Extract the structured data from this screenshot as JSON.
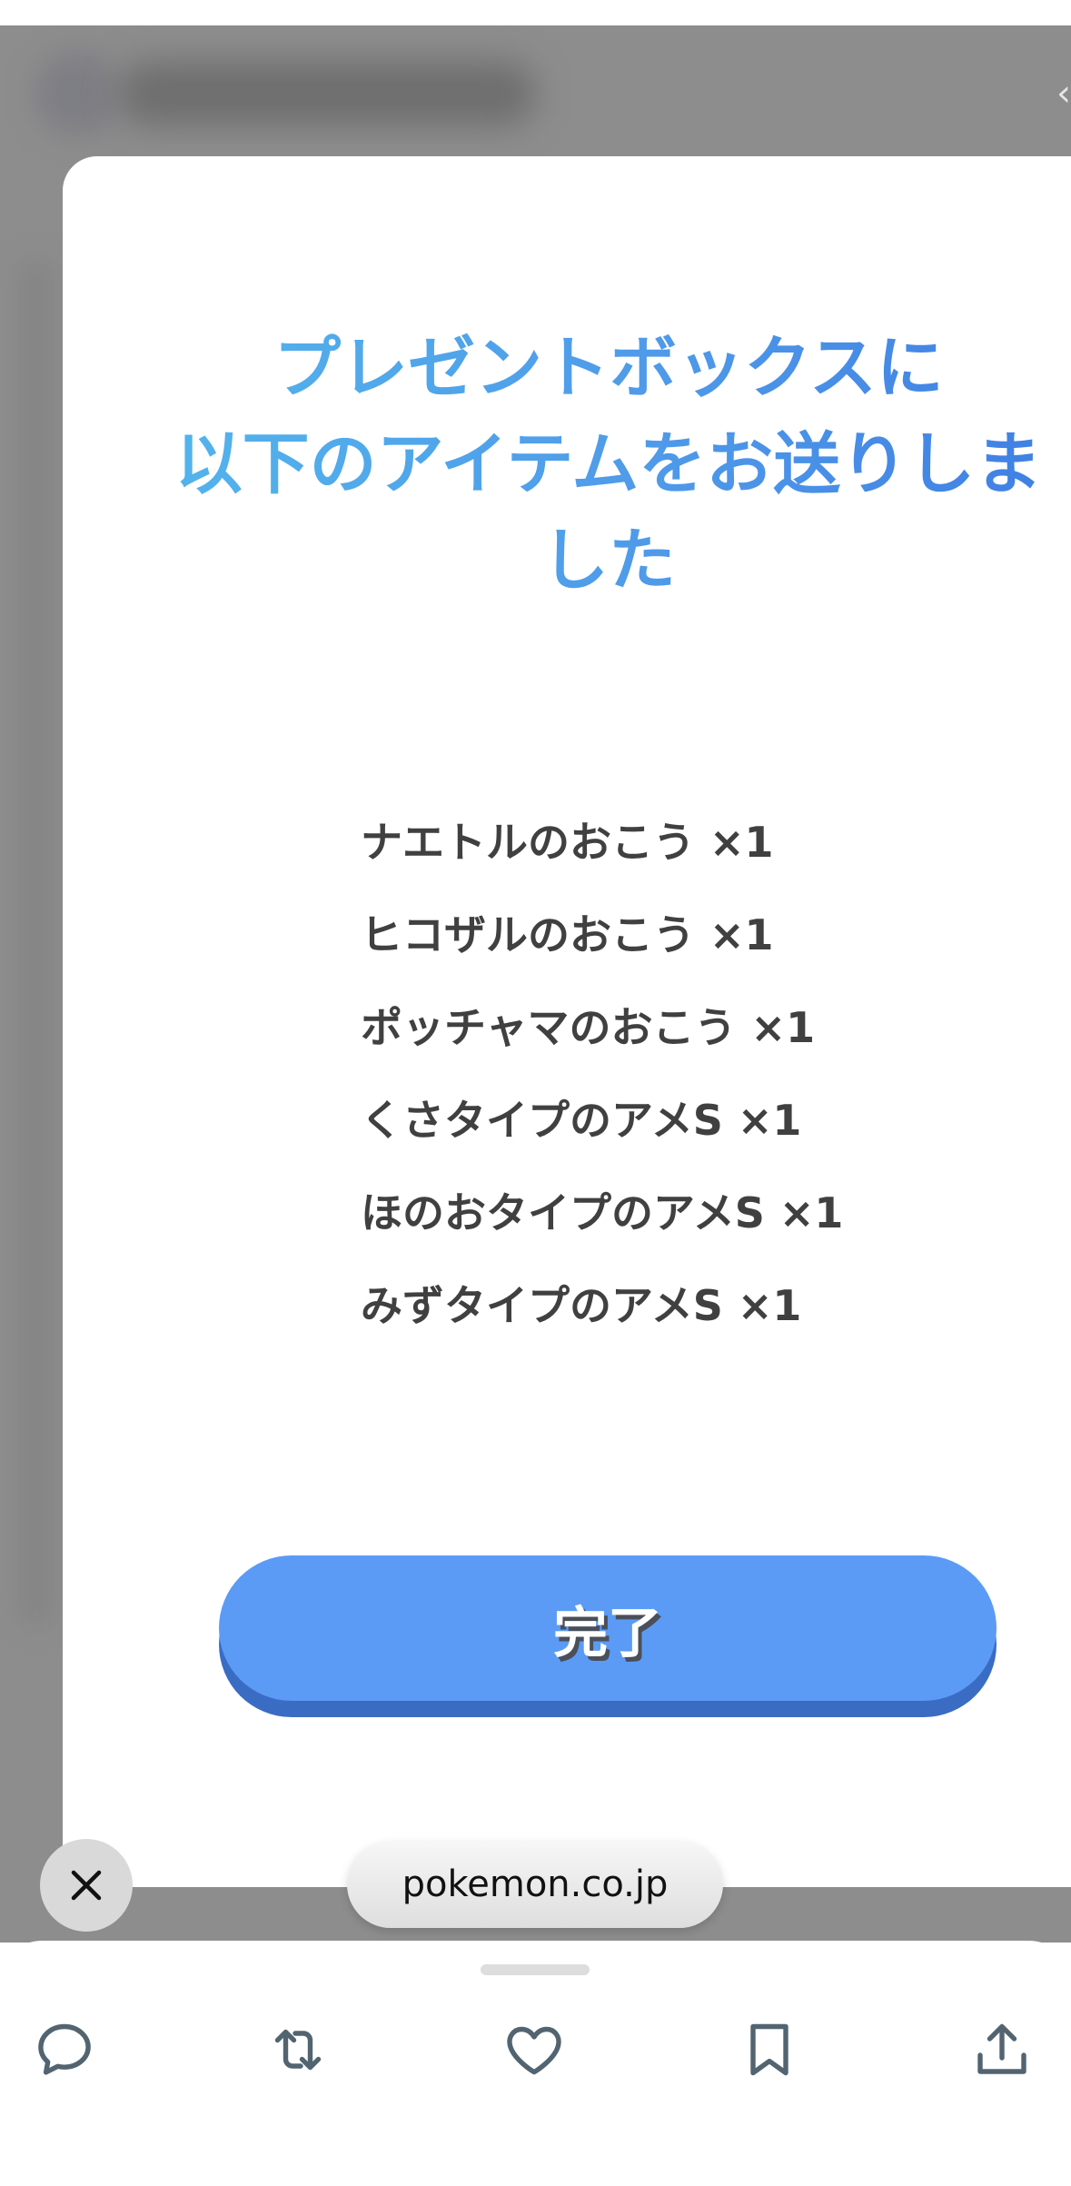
{
  "modal": {
    "title_lines": [
      "プレゼントボックスに",
      "以下のアイテムをお送りしま",
      "した"
    ],
    "items": [
      "ナエトルのおこう ×1",
      "ヒコザルのおこう ×1",
      "ポッチャマのおこう ×1",
      "くさタイプのアメS ×1",
      "ほのおタイプのアメS ×1",
      "みずタイプのアメS ×1"
    ],
    "done_label": "完了"
  },
  "browser": {
    "url": "pokemon.co.jp"
  },
  "actions": {
    "icons": [
      "reply-icon",
      "repost-icon",
      "like-icon",
      "bookmark-icon",
      "share-icon"
    ]
  },
  "colors": {
    "title_gradient": [
      "#52b4ec",
      "#3f7fe4"
    ],
    "button": "#5b9bf5",
    "button_shadow": "#3a6cc3",
    "icon_gray": "#536471",
    "backdrop": "#8d8d8d"
  }
}
